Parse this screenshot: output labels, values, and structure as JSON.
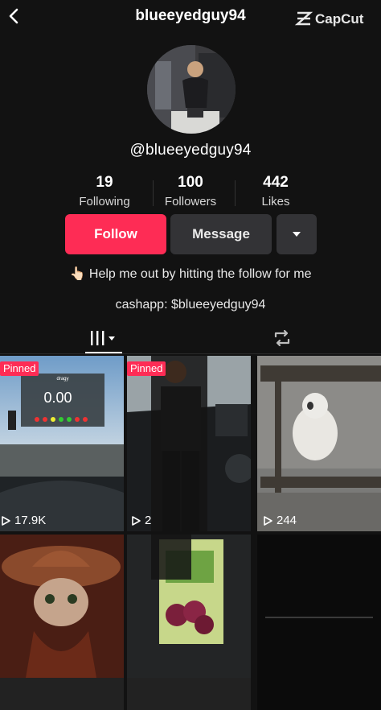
{
  "header": {
    "title": "blueeyedguy94",
    "watermark": "CapCut"
  },
  "profile": {
    "username": "@blueeyedguy94",
    "stats": [
      {
        "value": "19",
        "label": "Following"
      },
      {
        "value": "100",
        "label": "Followers"
      },
      {
        "value": "442",
        "label": "Likes"
      }
    ],
    "follow_label": "Follow",
    "message_label": "Message",
    "bio_emoji": "👆🏻",
    "bio": "Help me out by hitting the follow for me",
    "link": "cashapp: $blueeyedguy94"
  },
  "videos": [
    {
      "pinned": "Pinned",
      "views": "17.9K",
      "overlay_value": "0.00",
      "overlay_label": "dragy"
    },
    {
      "pinned": "Pinned",
      "views": "2"
    },
    {
      "views": "244"
    },
    {},
    {},
    {}
  ],
  "colors": {
    "accent": "#fe2c55",
    "background": "#121212",
    "button": "#333336"
  }
}
